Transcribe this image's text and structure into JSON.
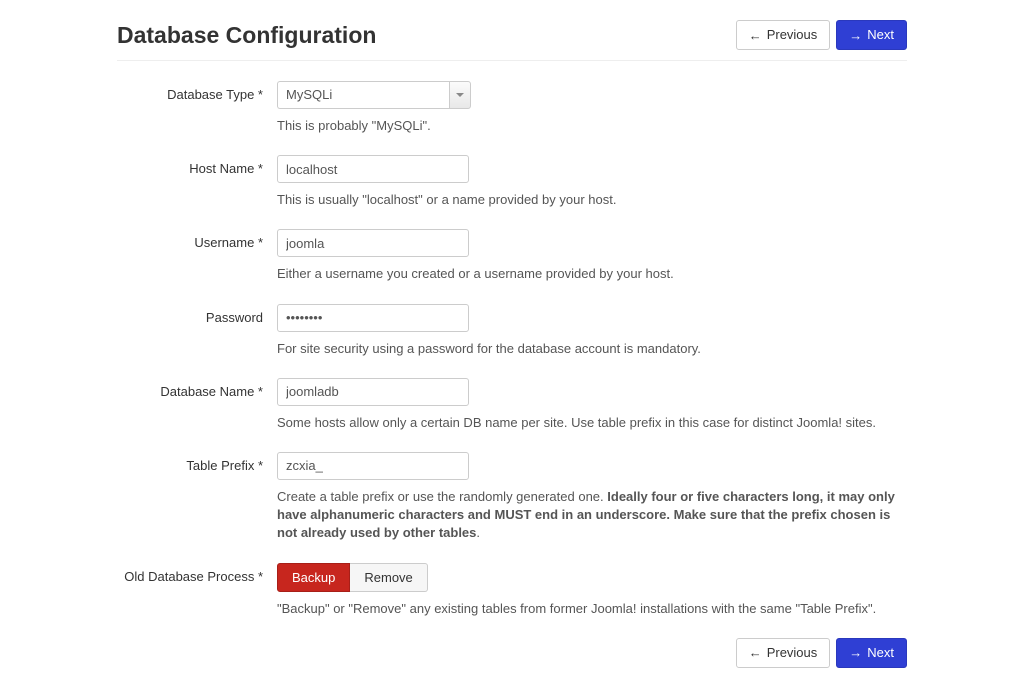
{
  "header": {
    "title": "Database Configuration",
    "previous_label": "Previous",
    "next_label": "Next"
  },
  "fields": {
    "db_type": {
      "label": "Database Type *",
      "value": "MySQLi",
      "help": "This is probably \"MySQLi\"."
    },
    "host_name": {
      "label": "Host Name *",
      "value": "localhost",
      "help": "This is usually \"localhost\" or a name provided by your host."
    },
    "username": {
      "label": "Username *",
      "value": "joomla",
      "help": "Either a username you created or a username provided by your host."
    },
    "password": {
      "label": "Password",
      "value": "••••••••",
      "help": "For site security using a password for the database account is mandatory."
    },
    "db_name": {
      "label": "Database Name *",
      "value": "joomladb",
      "help": "Some hosts allow only a certain DB name per site. Use table prefix in this case for distinct Joomla! sites."
    },
    "table_prefix": {
      "label": "Table Prefix *",
      "value": "zcxia_",
      "help_pre": "Create a table prefix or use the randomly generated one. ",
      "help_bold": "Ideally four or five characters long, it may only have alphanumeric characters and MUST end in an underscore. Make sure that the prefix chosen is not already used by other tables",
      "help_post": "."
    },
    "old_db": {
      "label": "Old Database Process *",
      "backup_label": "Backup",
      "remove_label": "Remove",
      "help": "\"Backup\" or \"Remove\" any existing tables from former Joomla! installations with the same \"Table Prefix\"."
    }
  },
  "footer": {
    "previous_label": "Previous",
    "next_label": "Next"
  }
}
